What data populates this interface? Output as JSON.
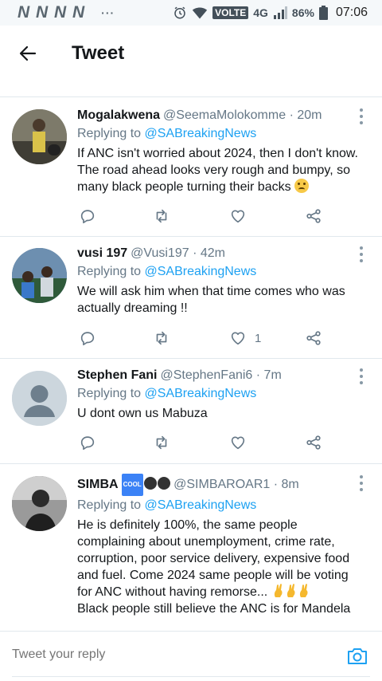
{
  "status_bar": {
    "left_icons": "N N N N",
    "dots": "···",
    "volte": "VOLTE",
    "network": "4G",
    "battery": "86%",
    "time": "07:06"
  },
  "header": {
    "title": "Tweet"
  },
  "tweets": [
    {
      "name": "Mogalakwena",
      "handle": "@SeemaMolokomme",
      "time": "· 20m",
      "replying_to": "Replying to",
      "mention": "@SABreakingNews",
      "text": "If ANC isn't worried about 2024, then I don't know. The road ahead looks very rough and bumpy, so many black people turning their backs",
      "likes": ""
    },
    {
      "name": "vusi 197",
      "handle": "@Vusi197",
      "time": "· 42m",
      "replying_to": "Replying to",
      "mention": "@SABreakingNews",
      "text": "We will ask him when that time comes who was actually dreaming !!",
      "likes": "1"
    },
    {
      "name": "Stephen Fani",
      "handle": "@StephenFani6",
      "time": "· 7m",
      "replying_to": "Replying to",
      "mention": "@SABreakingNews",
      "text": "U dont own us Mabuza",
      "likes": ""
    },
    {
      "name": "SIMBA",
      "name_badge": "COOL",
      "handle": "@SIMBAROAR1",
      "time": "· 8m",
      "replying_to": "Replying to",
      "mention": "@SABreakingNews",
      "text": "He is definitely 100%, the same people complaining about unemployment, crime rate, corruption, poor service delivery, expensive food and fuel. Come 2024 same people will be voting for ANC without having remorse...",
      "text2": "Black people still believe the ANC is for Mandela",
      "likes": ""
    }
  ],
  "reply_bar": {
    "placeholder": "Tweet your reply"
  },
  "colors": {
    "accent": "#1da1f2",
    "muted": "#657786",
    "border": "#e1e8ed"
  }
}
